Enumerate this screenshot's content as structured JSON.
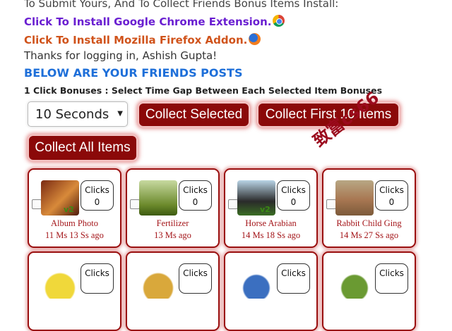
{
  "intro": {
    "submit_text": "To Submit Yours, And To Collect Friends Bonus Items Install:",
    "chrome_link": "Click To Install Google Chrome Extension.",
    "firefox_link": "Click To Install Mozilla Firefox Addon.",
    "thanks": "Thanks for logging in, Ashish Gupta!",
    "heading": "BELOW ARE YOUR FRIENDS POSTS",
    "bonus_note": "1 Click Bonuses : Select Time Gap Between Each Selected Item Bonuses"
  },
  "controls": {
    "time_gap_selected": "10 Seconds",
    "collect_selected": "Collect Selected",
    "collect_first_10": "Collect First 10 Items",
    "collect_all": "Collect All Items"
  },
  "watermark": "致富cs66",
  "icons": {
    "chrome": "chrome-icon",
    "firefox": "firefox-icon",
    "dropdown": "chevron-down-icon"
  },
  "cards": [
    {
      "name": "Album Photo",
      "time": "11 Ms 13 Ss ago",
      "clicks_label": "Clicks",
      "clicks": "0",
      "badge": "v2"
    },
    {
      "name": "Fertilizer",
      "time": "13 Ms ago",
      "clicks_label": "Clicks",
      "clicks": "0",
      "badge": ""
    },
    {
      "name": "Horse Arabian",
      "time": "14 Ms 18 Ss ago",
      "clicks_label": "Clicks",
      "clicks": "0",
      "badge": "v2"
    },
    {
      "name": "Rabbit Child Ging",
      "time": "14 Ms 27 Ss ago",
      "clicks_label": "Clicks",
      "clicks": "0",
      "badge": ""
    },
    {
      "name": "",
      "time": "",
      "clicks_label": "Clicks",
      "clicks": "",
      "badge": ""
    },
    {
      "name": "",
      "time": "",
      "clicks_label": "Clicks",
      "clicks": "",
      "badge": ""
    },
    {
      "name": "",
      "time": "",
      "clicks_label": "Clicks",
      "clicks": "",
      "badge": ""
    },
    {
      "name": "",
      "time": "",
      "clicks_label": "Clicks",
      "clicks": "",
      "badge": ""
    }
  ]
}
